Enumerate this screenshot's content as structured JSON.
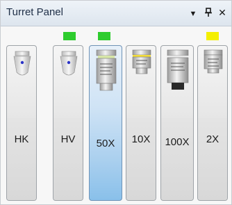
{
  "panel": {
    "title": "Turret Panel",
    "controls": {
      "dropdown": "▼",
      "pin": "†",
      "close": "✕"
    }
  },
  "colors": {
    "indicator_green": "#2ecc2e",
    "indicator_yellow": "#f4ef00",
    "selected_slot": "#a9cfee"
  },
  "turret": {
    "positions": [
      {
        "label": "HK",
        "icon": "lens-cap-icon",
        "indicator": "none"
      },
      {
        "label": "HV",
        "icon": "lens-cap-icon",
        "indicator": "green"
      },
      {
        "label": "50X",
        "icon": "objective-lens-icon",
        "indicator": "green",
        "selected": true
      },
      {
        "label": "10X",
        "icon": "objective-lens-icon",
        "indicator": "none"
      },
      {
        "label": "100X",
        "icon": "objective-lens-icon",
        "indicator": "none"
      },
      {
        "label": "2X",
        "icon": "objective-lens-icon",
        "indicator": "yellow"
      }
    ]
  }
}
